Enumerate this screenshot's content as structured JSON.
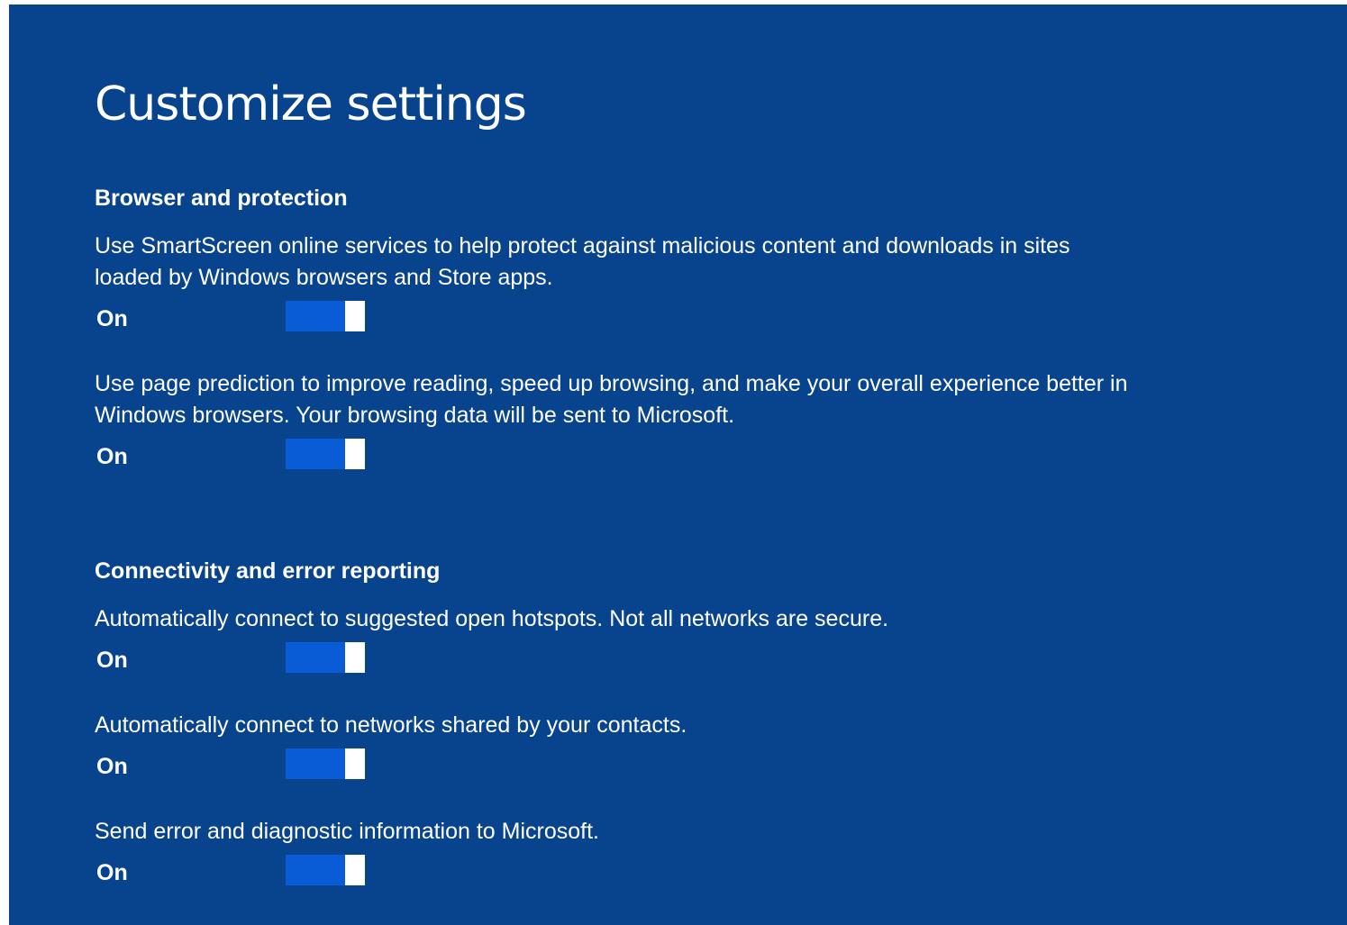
{
  "page": {
    "title": "Customize settings",
    "background_color": "#08438e",
    "toggle_color": "#0a5cd6"
  },
  "sections": [
    {
      "heading": "Browser and protection",
      "settings": [
        {
          "description": "Use SmartScreen online services to help protect against malicious content and downloads in sites loaded by Windows browsers and Store apps.",
          "state": "On"
        },
        {
          "description": "Use page prediction to improve reading, speed up browsing, and make your overall experience better in Windows browsers. Your browsing data will be sent to Microsoft.",
          "state": "On"
        }
      ]
    },
    {
      "heading": "Connectivity and error reporting",
      "settings": [
        {
          "description": "Automatically connect to suggested open hotspots. Not all networks are secure.",
          "state": "On"
        },
        {
          "description": "Automatically connect to networks shared by your contacts.",
          "state": "On"
        },
        {
          "description": "Send error and diagnostic information to Microsoft.",
          "state": "On"
        }
      ]
    }
  ]
}
